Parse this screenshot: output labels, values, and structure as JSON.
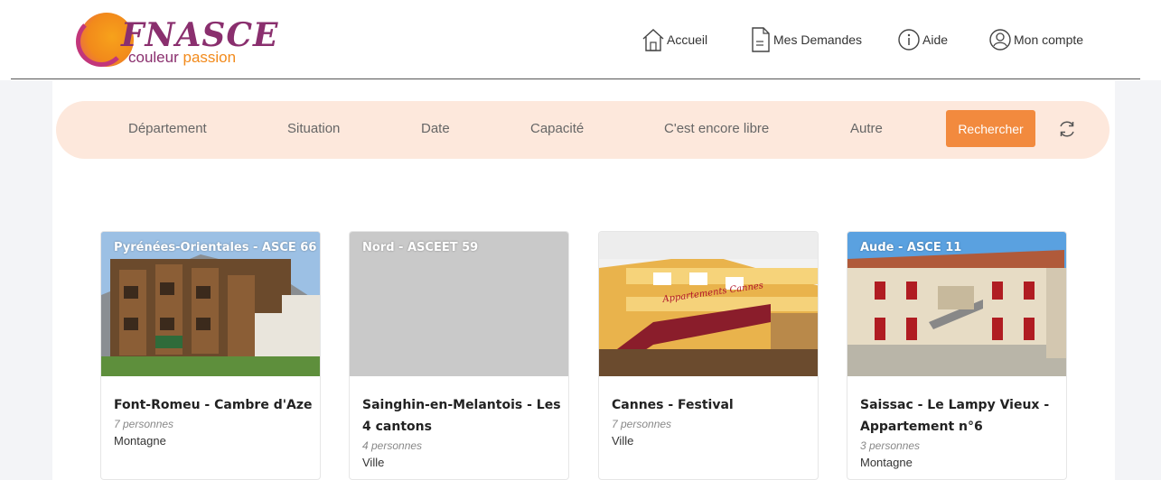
{
  "header": {
    "logo_word": "FNASCE",
    "logo_sub_1": "couleur ",
    "logo_sub_2": "passion",
    "nav": [
      {
        "label": "Accueil",
        "icon": "home-icon"
      },
      {
        "label": "Mes Demandes",
        "icon": "document-icon"
      },
      {
        "label": "Aide",
        "icon": "info-icon"
      },
      {
        "label": "Mon compte",
        "icon": "user-icon"
      }
    ]
  },
  "filters": {
    "items": [
      "Département",
      "Situation",
      "Date",
      "Capacité",
      "C'est encore libre",
      "Autre"
    ],
    "search_label": "Rechercher",
    "refresh_icon": "refresh-icon",
    "accent": "#f28a3e"
  },
  "cards": [
    {
      "tag": "Pyrénées-Orientales - ASCE 66",
      "title": "Font-Romeu - Cambre d'Aze",
      "capacity": "7 personnes",
      "type": "Montagne"
    },
    {
      "tag": "Nord - ASCEET 59",
      "title": "Sainghin-en-Melantois - Les 4 cantons",
      "capacity": "4 personnes",
      "type": "Ville"
    },
    {
      "tag": "",
      "title": "Cannes - Festival",
      "capacity": "7 personnes",
      "type": "Ville",
      "image_text": "Appartements Cannes"
    },
    {
      "tag": "Aude - ASCE 11",
      "title": "Saissac - Le Lampy Vieux - Appartement n°6",
      "capacity": "3 personnes",
      "type": "Montagne"
    }
  ]
}
